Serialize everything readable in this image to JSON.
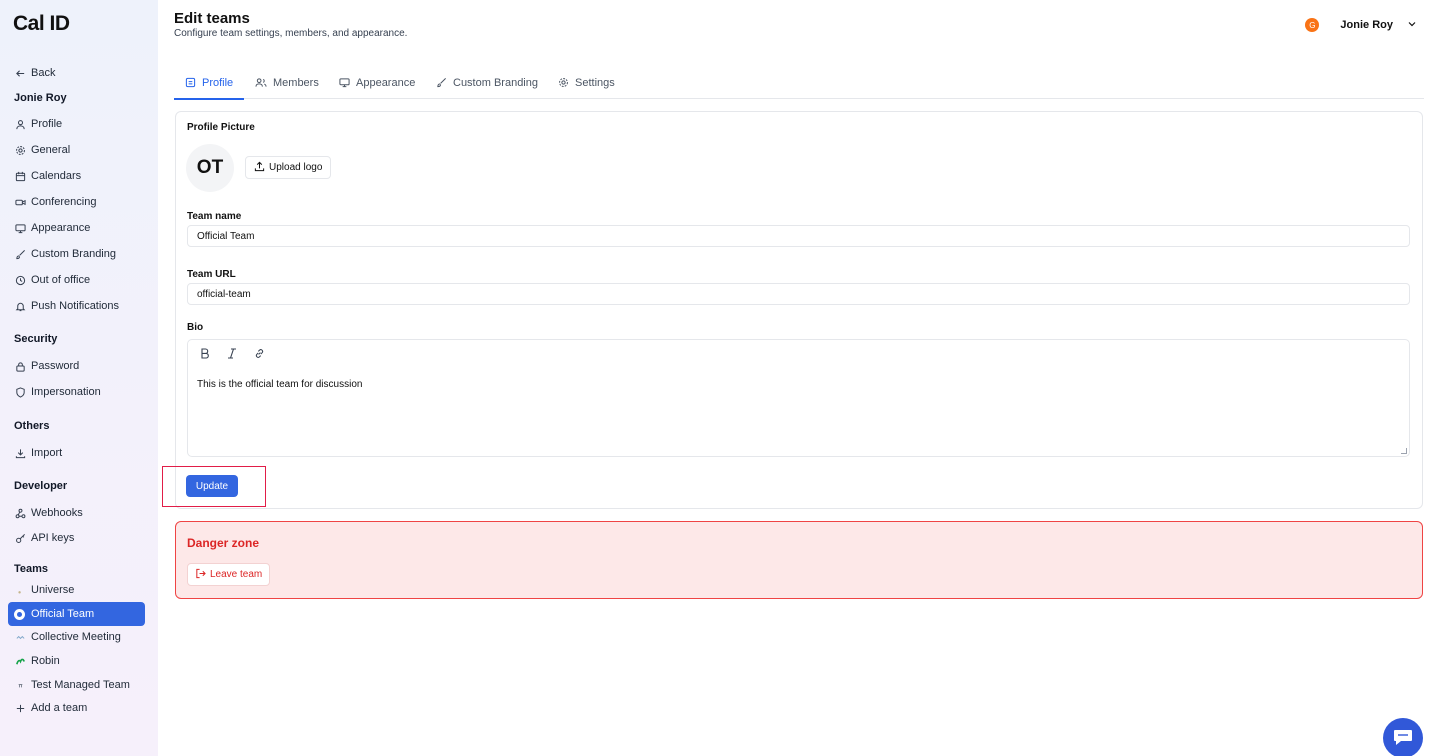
{
  "sidebar": {
    "logo": "Cal ID",
    "back": "Back",
    "user_section": "Jonie Roy",
    "profile_items": [
      {
        "label": "Profile",
        "icon": "user-icon"
      },
      {
        "label": "General",
        "icon": "gear-icon"
      },
      {
        "label": "Calendars",
        "icon": "calendar-icon"
      },
      {
        "label": "Conferencing",
        "icon": "video-icon"
      },
      {
        "label": "Appearance",
        "icon": "monitor-icon"
      },
      {
        "label": "Custom Branding",
        "icon": "brush-icon"
      },
      {
        "label": "Out of office",
        "icon": "clock-icon"
      },
      {
        "label": "Push Notifications",
        "icon": "bell-icon"
      }
    ],
    "security_heading": "Security",
    "security_items": [
      {
        "label": "Password",
        "icon": "lock-icon"
      },
      {
        "label": "Impersonation",
        "icon": "shield-icon"
      }
    ],
    "others_heading": "Others",
    "others_items": [
      {
        "label": "Import",
        "icon": "download-icon"
      }
    ],
    "developer_heading": "Developer",
    "developer_items": [
      {
        "label": "Webhooks",
        "icon": "webhook-icon"
      },
      {
        "label": "API keys",
        "icon": "key-icon"
      }
    ],
    "teams_heading": "Teams",
    "teams": [
      {
        "label": "Universe"
      },
      {
        "label": "Official Team",
        "active": true
      },
      {
        "label": "Collective Meeting"
      },
      {
        "label": "Robin"
      },
      {
        "label": "Test Managed Team"
      }
    ],
    "add_team": "Add a team"
  },
  "header": {
    "title": "Edit teams",
    "subtitle": "Configure team settings, members, and appearance.",
    "user_initial": "G",
    "user_name": "Jonie Roy"
  },
  "tabs": [
    {
      "label": "Profile",
      "active": true
    },
    {
      "label": "Members"
    },
    {
      "label": "Appearance"
    },
    {
      "label": "Custom Branding"
    },
    {
      "label": "Settings"
    }
  ],
  "form": {
    "profile_picture_label": "Profile Picture",
    "avatar_initials": "OT",
    "upload_label": "Upload logo",
    "team_name_label": "Team name",
    "team_name_value": "Official Team",
    "team_url_label": "Team URL",
    "team_url_value": "official-team",
    "bio_label": "Bio",
    "bio_value": "This is the official team for discussion",
    "update_label": "Update"
  },
  "danger": {
    "title": "Danger zone",
    "leave_label": "Leave team"
  },
  "colors": {
    "primary": "#3366e0",
    "danger": "#dc2626",
    "danger_bg": "#fde8e8"
  }
}
